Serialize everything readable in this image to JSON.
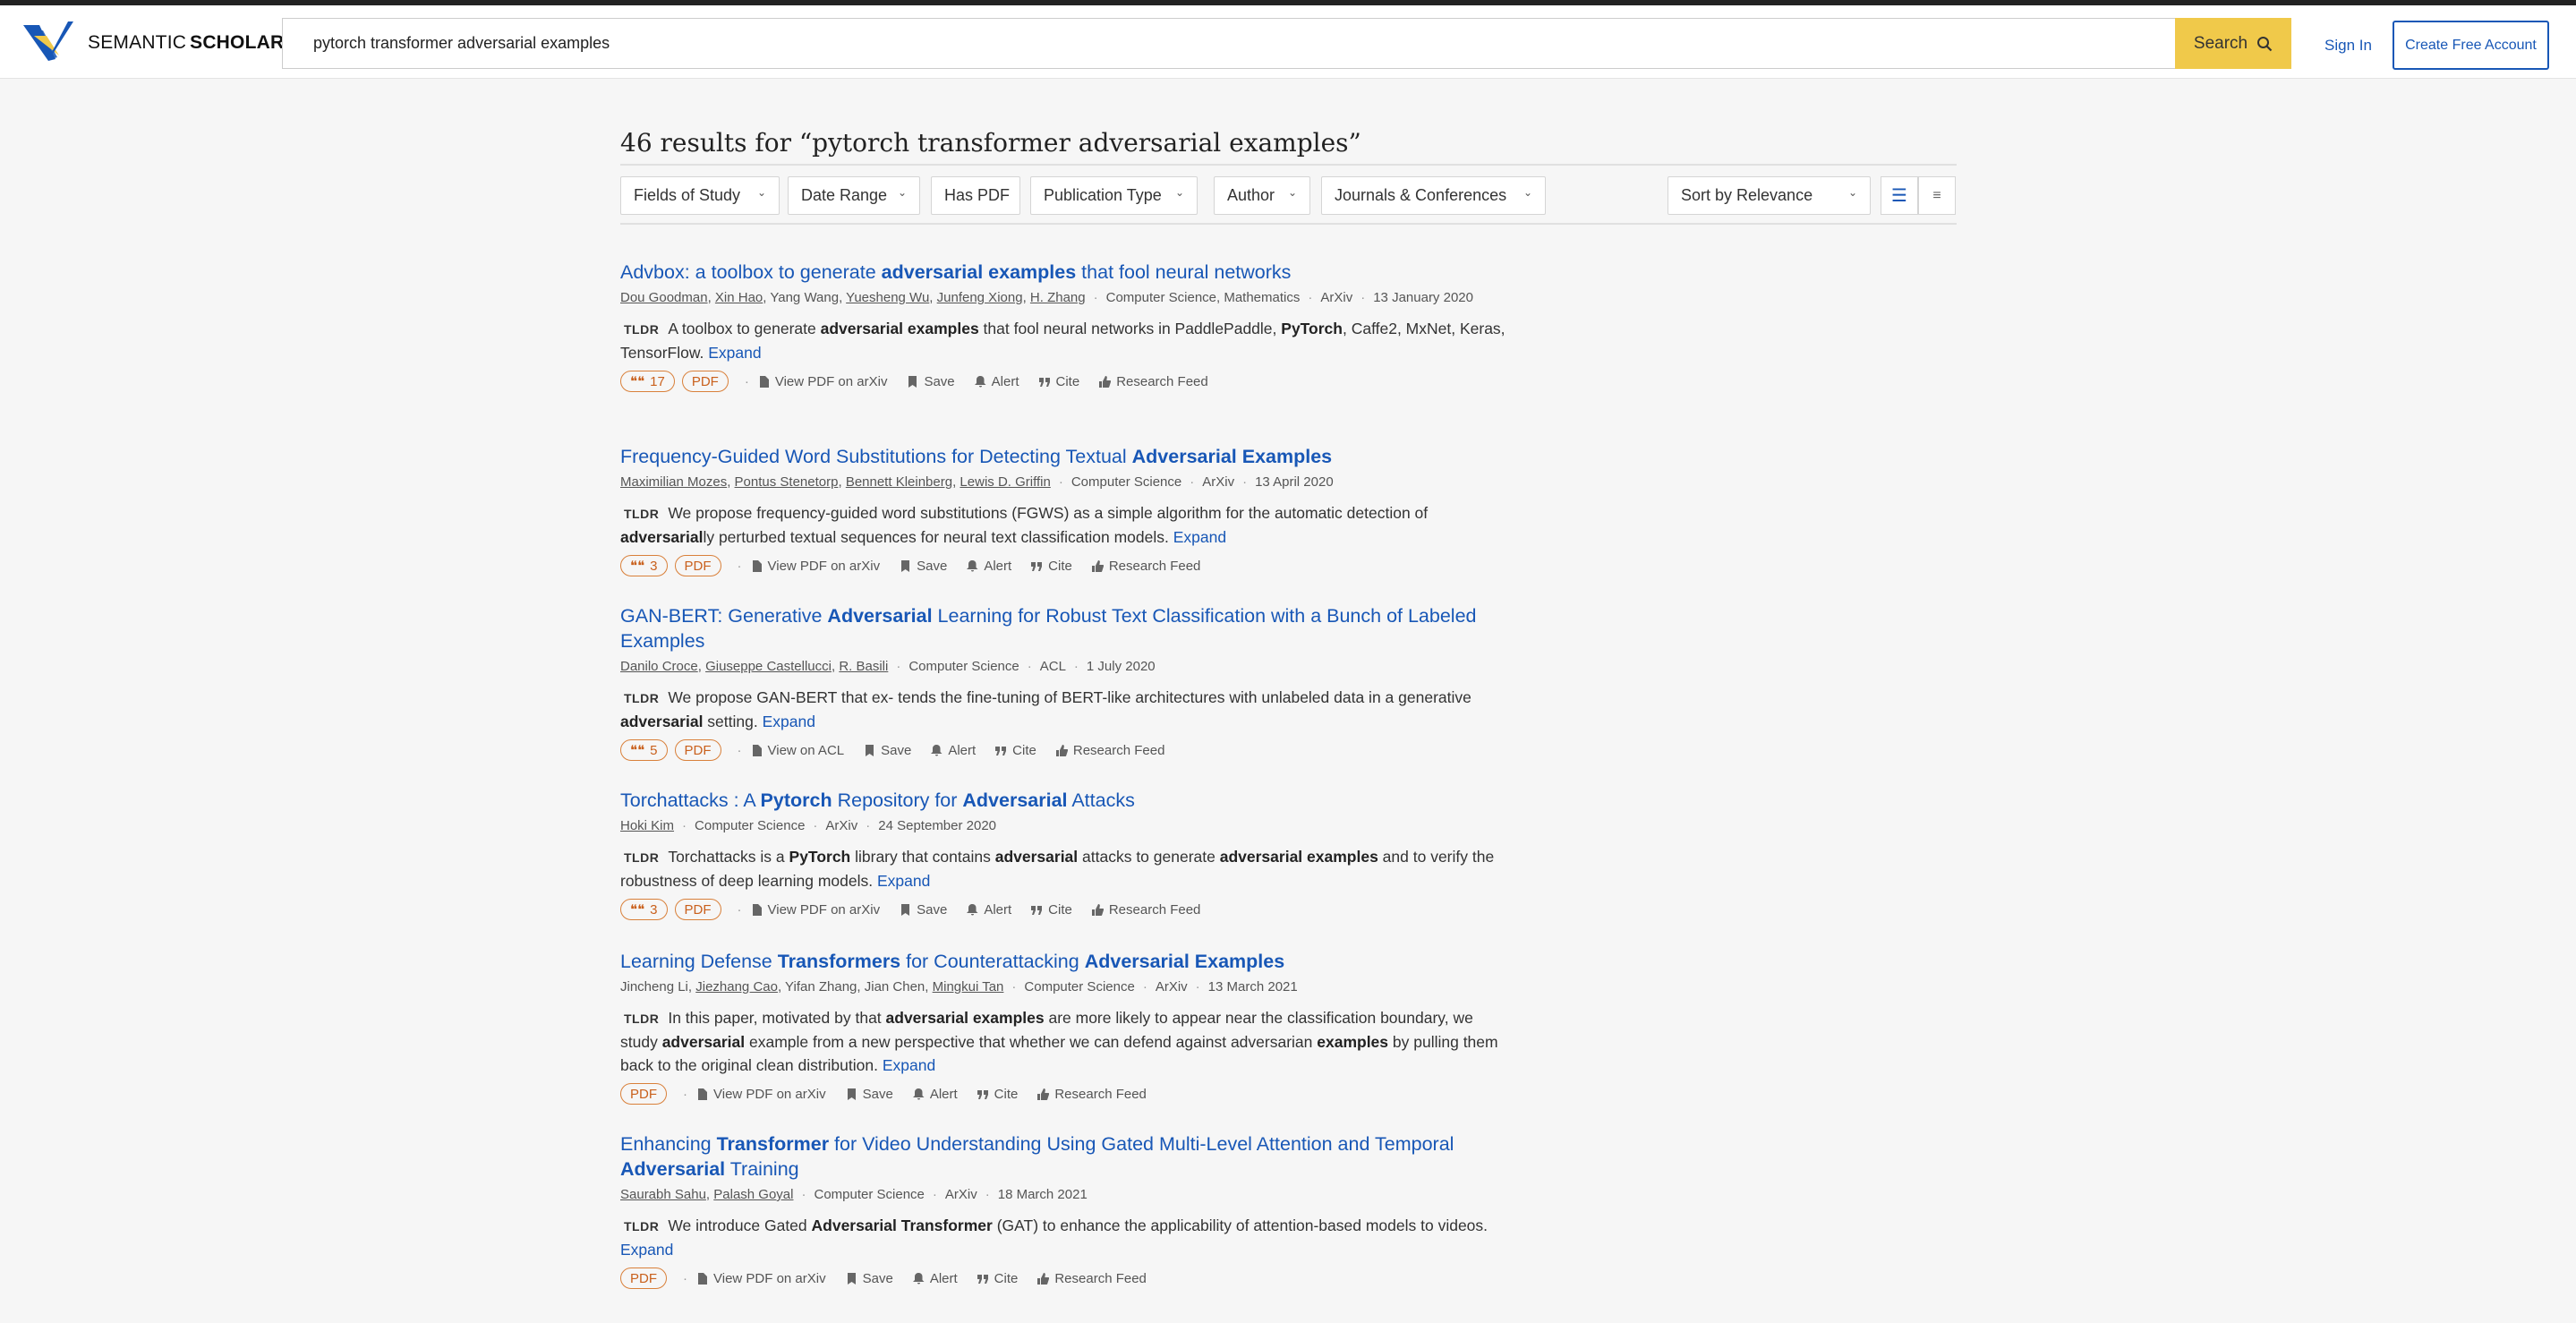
{
  "brand": {
    "name_light": "SEMANTIC",
    "name_bold": "SCHOLAR"
  },
  "search": {
    "value": "pytorch transformer adversarial examples",
    "button_label": "Search"
  },
  "header": {
    "sign_in": "Sign In",
    "create_account": "Create Free Account"
  },
  "results_heading": "46 results for “pytorch transformer adversarial examples”",
  "filters": [
    "Fields of Study",
    "Date Range",
    "Has PDF",
    "Publication Type",
    "Author",
    "Journals & Conferences"
  ],
  "sort": "Sort by Relevance",
  "actions": {
    "save": "Save",
    "alert": "Alert",
    "cite": "Cite",
    "feed": "Research Feed",
    "expand": "Expand",
    "tldr": "TLDR",
    "pdf": "PDF"
  },
  "results": [
    {
      "title": [
        [
          "Advbox: a toolbox to generate ",
          false
        ],
        [
          "adversarial examples",
          true
        ],
        [
          " that fool neural networks",
          false
        ]
      ],
      "authors": [
        [
          "Dou Goodman",
          true
        ],
        [
          "Xin Hao",
          true
        ],
        [
          "Yang Wang",
          false
        ],
        [
          "Yuesheng Wu",
          true
        ],
        [
          "Junfeng Xiong",
          true
        ],
        [
          "H. Zhang",
          true
        ]
      ],
      "meta": [
        "Computer Science, Mathematics",
        "ArXiv",
        "13 January 2020"
      ],
      "tldr": [
        [
          "A toolbox to generate ",
          false
        ],
        [
          "adversarial examples",
          true
        ],
        [
          " that fool neural networks in PaddlePaddle, ",
          false
        ],
        [
          "PyTorch",
          true
        ],
        [
          ", Caffe2, MxNet, Keras, TensorFlow.",
          false
        ]
      ],
      "citations": "17",
      "view": "View PDF on arXiv"
    },
    {
      "title": [
        [
          "Frequency-Guided Word Substitutions for Detecting Textual ",
          false
        ],
        [
          "Adversarial Examples",
          true
        ]
      ],
      "authors": [
        [
          "Maximilian Mozes",
          true
        ],
        [
          "Pontus Stenetorp",
          true
        ],
        [
          "Bennett Kleinberg",
          true
        ],
        [
          "Lewis D. Griffin",
          true
        ]
      ],
      "meta": [
        "Computer Science",
        "ArXiv",
        "13 April 2020"
      ],
      "tldr": [
        [
          "We propose frequency-guided word substitutions (FGWS) as a simple algorithm for the automatic detection of ",
          false
        ],
        [
          "adversarial",
          true
        ],
        [
          "ly perturbed textual sequences for neural text classification models.",
          false
        ]
      ],
      "citations": "3",
      "view": "View PDF on arXiv"
    },
    {
      "title": [
        [
          "GAN-BERT: Generative ",
          false
        ],
        [
          "Adversarial",
          true
        ],
        [
          " Learning for Robust Text Classification with a Bunch of Labeled Examples",
          false
        ]
      ],
      "authors": [
        [
          "Danilo Croce",
          true
        ],
        [
          "Giuseppe Castellucci",
          true
        ],
        [
          "R. Basili",
          true
        ]
      ],
      "meta": [
        "Computer Science",
        "ACL",
        "1 July 2020"
      ],
      "tldr": [
        [
          "We propose GAN-BERT that ex- tends the fine-tuning of BERT-like architectures with unlabeled data in a generative ",
          false
        ],
        [
          "adversarial",
          true
        ],
        [
          " setting.",
          false
        ]
      ],
      "citations": "5",
      "view": "View on ACL"
    },
    {
      "title": [
        [
          "Torchattacks : A ",
          false
        ],
        [
          "Pytorch",
          true
        ],
        [
          " Repository for ",
          false
        ],
        [
          "Adversarial",
          true
        ],
        [
          " Attacks",
          false
        ]
      ],
      "authors": [
        [
          "Hoki Kim",
          true
        ]
      ],
      "meta": [
        "Computer Science",
        "ArXiv",
        "24 September 2020"
      ],
      "tldr": [
        [
          "Torchattacks is a ",
          false
        ],
        [
          "PyTorch",
          true
        ],
        [
          " library that contains ",
          false
        ],
        [
          "adversarial",
          true
        ],
        [
          " attacks to generate ",
          false
        ],
        [
          "adversarial examples",
          true
        ],
        [
          " and to verify the robustness of deep learning models.",
          false
        ]
      ],
      "citations": "3",
      "view": "View PDF on arXiv"
    },
    {
      "title": [
        [
          "Learning Defense ",
          false
        ],
        [
          "Transformers",
          true
        ],
        [
          " for Counterattacking ",
          false
        ],
        [
          "Adversarial Examples",
          true
        ]
      ],
      "authors": [
        [
          "Jincheng Li",
          false
        ],
        [
          "Jiezhang Cao",
          true
        ],
        [
          "Yifan Zhang",
          false
        ],
        [
          "Jian Chen",
          false
        ],
        [
          "Mingkui Tan",
          true
        ]
      ],
      "meta": [
        "Computer Science",
        "ArXiv",
        "13 March 2021"
      ],
      "tldr": [
        [
          "In this paper, motivated by that ",
          false
        ],
        [
          "adversarial examples",
          true
        ],
        [
          " are more likely to appear near the classification boundary, we study ",
          false
        ],
        [
          "adversarial",
          true
        ],
        [
          " example from a new perspective that whether we can defend against adversarian ",
          false
        ],
        [
          "examples",
          true
        ],
        [
          " by pulling them back to the original clean distribution.",
          false
        ]
      ],
      "citations": "",
      "view": "View PDF on arXiv"
    },
    {
      "title": [
        [
          "Enhancing ",
          false
        ],
        [
          "Transformer",
          true
        ],
        [
          " for Video Understanding Using Gated Multi-Level Attention and Temporal ",
          false
        ],
        [
          "Adversarial",
          true
        ],
        [
          " Training",
          false
        ]
      ],
      "authors": [
        [
          "Saurabh Sahu",
          true
        ],
        [
          "Palash Goyal",
          true
        ]
      ],
      "meta": [
        "Computer Science",
        "ArXiv",
        "18 March 2021"
      ],
      "tldr": [
        [
          "We introduce Gated ",
          false
        ],
        [
          "Adversarial Transformer",
          true
        ],
        [
          " (GAT) to enhance the applicability of attention-based models to videos.",
          false
        ]
      ],
      "citations": "",
      "view": "View PDF on arXiv"
    }
  ]
}
